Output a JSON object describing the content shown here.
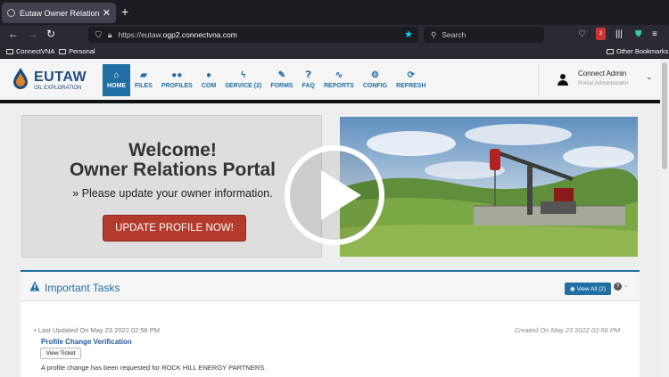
{
  "browser": {
    "tab_title": "Eutaw Owner Relations powered",
    "url_prefix": "https://eutaw.",
    "url_domain": "ogp2.connectvna.com",
    "search_placeholder": "Search",
    "ext_badge": "3",
    "bookmarks": [
      "ConnectVNA",
      "Personal"
    ],
    "other_bookmarks": "Other Bookmarks"
  },
  "header": {
    "logo_main": "EUTAW",
    "logo_sub": "OIL EXPLORATION",
    "nav": [
      {
        "label": "HOME",
        "icon": "home-icon"
      },
      {
        "label": "FILES",
        "icon": "folder-icon"
      },
      {
        "label": "PROFILES",
        "icon": "users-icon"
      },
      {
        "label": "COM",
        "icon": "chat-icon"
      },
      {
        "label": "SERVICE (2)",
        "icon": "bolt-icon"
      },
      {
        "label": "FORMS",
        "icon": "edit-icon"
      },
      {
        "label": "FAQ",
        "icon": "question-icon"
      },
      {
        "label": "REPORTS",
        "icon": "chart-icon"
      },
      {
        "label": "CONFIG",
        "icon": "gear-icon"
      },
      {
        "label": "REFRESH",
        "icon": "refresh-icon"
      }
    ],
    "user_name": "Connect Admin",
    "user_role": "Portal Administrator"
  },
  "welcome": {
    "line1": "Welcome!",
    "line2": "Owner Relations Portal",
    "line3": "» Please update your owner information.",
    "button": "UPDATE PROFILE NOW!"
  },
  "tasks": {
    "title": "Important Tasks",
    "view_all": "View All (2)",
    "help": "?",
    "item": {
      "updated": "Last Updated On May 23 2022 02:56 PM",
      "created": "Created On May 23 2022 02:56 PM",
      "title": "Profile Change Verification",
      "button": "View Ticket",
      "description": "A profile change has been requested for ROCK HILL ENERGY PARTNERS."
    }
  },
  "colors": {
    "accent": "#1f6fa5",
    "cta": "#b33a2c"
  }
}
